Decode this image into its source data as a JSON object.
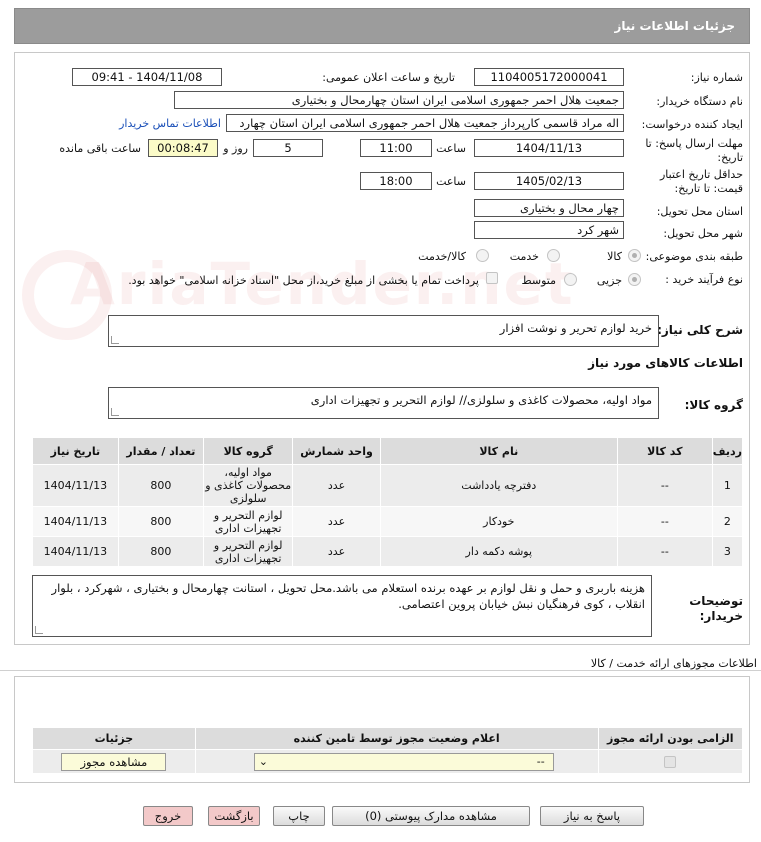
{
  "header": {
    "title": "جزئیات اطلاعات نیاز"
  },
  "form": {
    "need_number_label": "شماره نیاز:",
    "need_number": "1104005172000041",
    "announce_label": "تاریخ و ساعت اعلان عمومی:",
    "announce_value": "1404/11/08 - 09:41",
    "buyer_org_label": "نام دستگاه خریدار:",
    "buyer_org": "جمعیت هلال احمر جمهوری اسلامی ایران استان چهارمحال و بختیاری",
    "creator_label": "ایجاد کننده درخواست:",
    "creator": "اله مراد قاسمی کارپرداز جمعیت هلال احمر جمهوری اسلامی ایران استان چهارد",
    "contact_link": "اطلاعات تماس خریدار",
    "deadline_label_1": "مهلت ارسال پاسخ: تا",
    "deadline_label_2": "تاریخ:",
    "deadline_date": "1404/11/13",
    "time_label": "ساعت",
    "deadline_time": "11:00",
    "days_value": "5",
    "days_label": "روز و",
    "remaining_time": "00:08:47",
    "remaining_label": "ساعت باقی مانده",
    "validity_label_1": "حداقل تاریخ اعتبار",
    "validity_label_2": "قیمت: تا تاریخ:",
    "validity_date": "1405/02/13",
    "validity_time_label": "ساعت",
    "validity_time": "18:00",
    "province_label": "استان محل تحویل:",
    "province": "چهار محال و بختیاری",
    "city_label": "شهر محل تحویل:",
    "city": "شهر کرد",
    "category_label": "طبقه بندی موضوعی:",
    "category_options": [
      "کالا",
      "خدمت",
      "کالا/خدمت"
    ],
    "purchase_type_label": "نوع فرآیند خرید :",
    "purchase_options": [
      "جزیی",
      "متوسط"
    ],
    "payment_note": "پرداخت تمام یا بخشی از مبلغ خرید،از محل \"اسناد خزانه اسلامی\" خواهد بود.",
    "summary_label": "شرح کلی نیاز:",
    "summary": "خرید لوازم  تحریر و نوشت افزار",
    "goods_info_label": "اطلاعات کالاهای مورد نیاز",
    "goods_group_label": "گروه کالا:",
    "goods_group": "مواد اولیه، محصولات کاغذی و سلولزی// لوازم التحریر و تجهیزات اداری"
  },
  "items_table": {
    "headers": [
      "ردیف",
      "کد کالا",
      "نام کالا",
      "واحد شمارش",
      "گروه کالا",
      "تعداد / مقدار",
      "تاریخ نیاز"
    ],
    "rows": [
      [
        "1",
        "--",
        "دفترچه یادداشت",
        "عدد",
        "مواد اولیه، محصولات کاغذی و سلولزی",
        "800",
        "1404/11/13"
      ],
      [
        "2",
        "--",
        "خودکار",
        "عدد",
        "لوازم التحریر و تجهیزات اداری",
        "800",
        "1404/11/13"
      ],
      [
        "3",
        "--",
        "پوشه دکمه دار",
        "عدد",
        "لوازم التحریر و تجهیزات اداری",
        "800",
        "1404/11/13"
      ]
    ]
  },
  "buyer_notes": {
    "label_1": "توضیحات",
    "label_2": "خریدار:",
    "text": "هزینه باربری و حمل و نقل لوازم بر عهده برنده استعلام می باشد.محل تحویل ، استانت چهارمحال و بختیاری ، شهرکرد ، بلوار انقلاب ، کوی فرهنگیان نبش خیابان پروین اعتصامی."
  },
  "licenses": {
    "title": "اطلاعات مجوزهای ارائه خدمت / کالا",
    "headers": [
      "الزامی بودن ارائه مجوز",
      "اعلام وضعیت مجوز توسط تامین کننده",
      "جزئیات"
    ],
    "select_value": "--",
    "view_button": "مشاهده مجوز"
  },
  "buttons": {
    "reply": "پاسخ به نیاز",
    "attachments": "مشاهده مدارک پیوستی (0)",
    "print": "چاپ",
    "back": "بازگشت",
    "exit": "خروج"
  },
  "watermark": "AriaTender.net",
  "colors": {
    "header_bg": "#9c9c9c",
    "link": "#1a4fb8",
    "yellow_box": "#fbfbc8",
    "pink_button": "#f3c9c9"
  }
}
